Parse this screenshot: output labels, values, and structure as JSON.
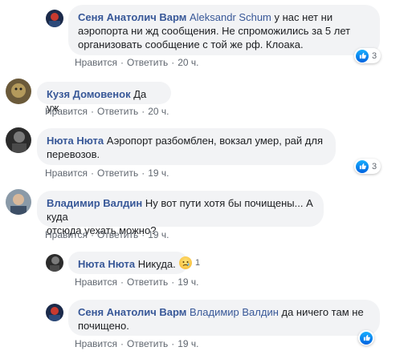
{
  "comments": [
    {
      "author": "Сеня Анатолич Варм",
      "mention": "Aleksandr Schum",
      "text": " у нас нет ни аэропорта ни жд сообщения. Не спроможились за 5 лет организовать сообщение с той же рф. Клоака.",
      "line1_rest": " у нас нет ни",
      "line2": "аэропорта ни жд сообщения. Не спроможились за 5 лет",
      "line3": "организовать сообщение с той же рф. Клоака.",
      "like": "Нравится",
      "reply": "Ответить",
      "time": "20 ч.",
      "reaction_count": "3"
    },
    {
      "author": "Кузя Домовенок",
      "text": "Да уж",
      "like": "Нравится",
      "reply": "Ответить",
      "time": "20 ч."
    },
    {
      "author": "Нюта Нюта",
      "line1_rest": " Аэропорт разбомблен, вокзал умер, рай для",
      "line2": "перевозов.",
      "like": "Нравится",
      "reply": "Ответить",
      "time": "19 ч.",
      "reaction_count": "3"
    },
    {
      "author": "Владимир Валдин",
      "line1_rest": " Ну вот пути хотя бы почищены... А куда",
      "line2": "отсюда уехать можно?",
      "like": "Нравится",
      "reply": "Ответить",
      "time": "19 ч."
    },
    {
      "author": "Нюта Нюта",
      "text": "Никуда.",
      "like": "Нравится",
      "reply": "Ответить",
      "time": "19 ч.",
      "reaction_count": "1"
    },
    {
      "author": "Сеня Анатолич Варм",
      "mention": "Владимир Валдин",
      "line1_rest": " да ничего там не",
      "line2": "почищено.",
      "like": "Нравится",
      "reply": "Ответить",
      "time": "19 ч."
    }
  ],
  "colors": {
    "author": "#385898",
    "bubble": "#f2f3f5",
    "meta": "#606770",
    "like": "#1877f2"
  },
  "icons": {
    "like": "thumbs-up-icon",
    "sad": "sad-face-icon"
  }
}
